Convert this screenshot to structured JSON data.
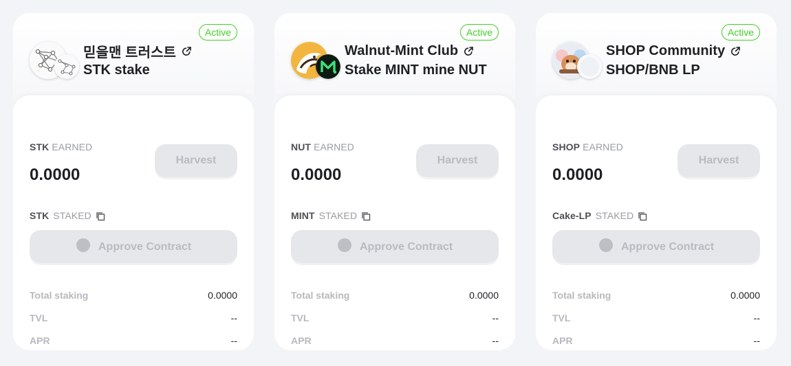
{
  "pools": [
    {
      "status": "Active",
      "title": "믿을맨 트러스트",
      "subtitle": "STK stake",
      "earned_token": "STK",
      "earned_suffix": "EARNED",
      "earned_value": "0.0000",
      "harvest_label": "Harvest",
      "staked_token": "STK",
      "staked_suffix": "STAKED",
      "approve_label": "Approve Contract",
      "total_staking_label": "Total staking",
      "total_staking_value": "0.0000",
      "tvl_label": "TVL",
      "tvl_value": "--",
      "apr_label": "APR",
      "apr_value": "--",
      "main_logo_icon": "stk-network-logo-icon",
      "sub_logo_icon": "stk-network-small-logo-icon"
    },
    {
      "status": "Active",
      "title": "Walnut-Mint Club",
      "subtitle": "Stake MINT mine NUT",
      "earned_token": "NUT",
      "earned_suffix": "EARNED",
      "earned_value": "0.0000",
      "harvest_label": "Harvest",
      "staked_token": "MINT",
      "staked_suffix": "STAKED",
      "approve_label": "Approve Contract",
      "total_staking_label": "Total staking",
      "total_staking_value": "0.0000",
      "tvl_label": "TVL",
      "tvl_value": "--",
      "apr_label": "APR",
      "apr_value": "--",
      "main_logo_icon": "squirrel-logo-icon",
      "sub_logo_icon": "mint-m-logo-icon"
    },
    {
      "status": "Active",
      "title": "SHOP Community",
      "subtitle": "SHOP/BNB LP",
      "earned_token": "SHOP",
      "earned_suffix": "EARNED",
      "earned_value": "0.0000",
      "harvest_label": "Harvest",
      "staked_token": "Cake-LP",
      "staked_suffix": "STAKED",
      "approve_label": "Approve Contract",
      "total_staking_label": "Total staking",
      "total_staking_value": "0.0000",
      "tvl_label": "TVL",
      "tvl_value": "--",
      "apr_label": "APR",
      "apr_value": "--",
      "main_logo_icon": "shop-hamster-logo-icon",
      "sub_logo_icon": "bnb-lp-logo-icon"
    }
  ],
  "colors": {
    "active_green": "#3fcf24",
    "page_bg": "#f3f4f7",
    "disabled_button_bg": "#e6e7ea",
    "disabled_button_text": "#b9bbc1"
  }
}
